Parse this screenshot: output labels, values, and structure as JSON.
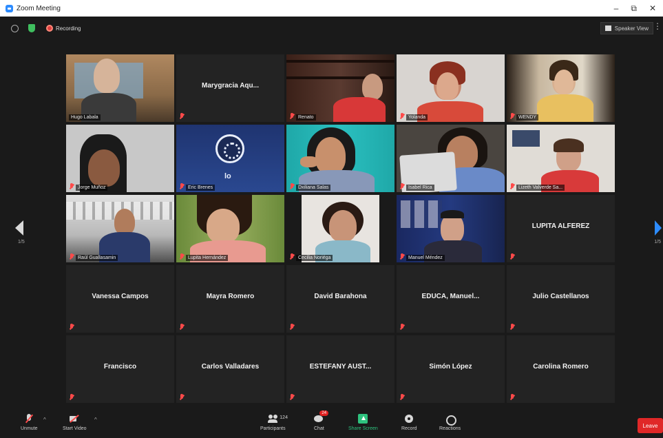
{
  "window": {
    "title": "Zoom Meeting",
    "minimize": "–",
    "restore": "⧉",
    "close": "✕"
  },
  "topbar": {
    "recording_label": "Recording",
    "view_label": "Speaker View"
  },
  "grid": {
    "tiles": [
      {
        "name": "Hugo Labala",
        "video": true
      },
      {
        "name": "Marygracia Aqu...",
        "video": false
      },
      {
        "name": "Renato",
        "video": true
      },
      {
        "name": "Yolanda",
        "video": true
      },
      {
        "name": "WENDY",
        "video": true
      },
      {
        "name": "Jorge Muñoz",
        "video": true
      },
      {
        "name": "Eric Brenes",
        "video": true
      },
      {
        "name": "Dxiliana Salas",
        "video": true
      },
      {
        "name": "Isabel Rica",
        "video": true
      },
      {
        "name": "Lizeth Valverde Sa...",
        "video": true
      },
      {
        "name": "Raúl Guallasamin",
        "video": true
      },
      {
        "name": "Lupita Hernández",
        "video": true
      },
      {
        "name": "Cecilia Noriéga",
        "video": true
      },
      {
        "name": "Manuel Méndez",
        "video": true
      },
      {
        "name": "LUPITA ALFEREZ",
        "video": false
      },
      {
        "name": "Vanessa Campos",
        "video": false
      },
      {
        "name": "Mayra Romero",
        "video": false
      },
      {
        "name": "David Barahona",
        "video": false
      },
      {
        "name": "EDUCA, Manuel...",
        "video": false
      },
      {
        "name": "Julio Castellanos",
        "video": false
      },
      {
        "name": "Francisco",
        "video": false
      },
      {
        "name": "Carlos Valladares",
        "video": false
      },
      {
        "name": "ESTEFANY AUST...",
        "video": false
      },
      {
        "name": "Simón López",
        "video": false
      },
      {
        "name": "Carolina Romero",
        "video": false
      }
    ],
    "obs_text": "lo"
  },
  "pagination": {
    "left_page": "1/5",
    "right_page": "1/5"
  },
  "toolbar": {
    "unmute": "Unmute",
    "start_video": "Start Video",
    "participants": "Participants",
    "participants_count": "124",
    "chat": "Chat",
    "chat_badge": "24",
    "share_screen": "Share Screen",
    "record": "Record",
    "reactions": "Reactions",
    "leave": "Leave"
  },
  "colors": {
    "accent": "#2d8cff",
    "active_speaker": "#d8e04a",
    "leave": "#e02828",
    "share": "#2ec27e",
    "muted": "#ff4a4a"
  }
}
